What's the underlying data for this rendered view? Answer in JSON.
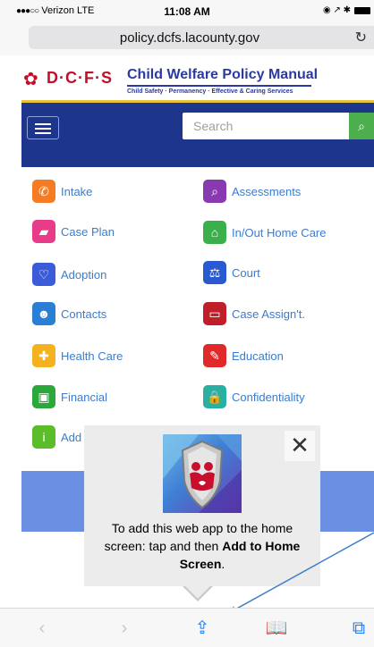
{
  "status_bar": {
    "signal_dots": "●●●○○",
    "carrier": "Verizon",
    "network": "LTE",
    "time": "11:08 AM",
    "right_icons": "◉ ↗ ✱"
  },
  "address_bar": {
    "url": "policy.dcfs.lacounty.gov",
    "reload_icon": "reload-icon"
  },
  "site": {
    "logo_text": "D·C·F·S",
    "title": "Child Welfare Policy Manual",
    "tagline": "Child Safety · Permanency · Effective & Caring Services",
    "search_placeholder": "Search",
    "accent_color": "#1d368c"
  },
  "menu": {
    "left": [
      {
        "label": "Intake",
        "icon": "phone-icon",
        "color": "#f57c22"
      },
      {
        "label": "Case Plan",
        "icon": "folder-icon",
        "color": "#e83b8a"
      },
      {
        "label": "Adoption",
        "icon": "heart-icon",
        "color": "#3b5bd8"
      },
      {
        "label": "Contacts",
        "icon": "contacts-icon",
        "color": "#2a7fd4"
      },
      {
        "label": "Health Care",
        "icon": "medical-kit-icon",
        "color": "#f4b21e"
      },
      {
        "label": "Financial",
        "icon": "money-icon",
        "color": "#2aa83a"
      },
      {
        "label": "Add",
        "icon": "info-icon",
        "color": "#5cbd2b"
      }
    ],
    "right": [
      {
        "label": "Assessments",
        "icon": "search-icon",
        "color": "#8a3ab0"
      },
      {
        "label": "In/Out Home Care",
        "icon": "home-icon",
        "color": "#3bb04a"
      },
      {
        "label": "Court",
        "icon": "scales-icon",
        "color": "#2a5ad0"
      },
      {
        "label": "Case Assign't.",
        "icon": "folder-open-icon",
        "color": "#c01f2a"
      },
      {
        "label": "Education",
        "icon": "pencil-icon",
        "color": "#e02a2a"
      },
      {
        "label": "Confidentiality",
        "icon": "lock-icon",
        "color": "#2ab0a0"
      }
    ]
  },
  "popup": {
    "text_before": "To add this web app to the home screen: tap",
    "text_middle": " and then ",
    "text_bold": "Add to Home Screen",
    "text_end": "."
  },
  "toolbar": {
    "back": "‹",
    "forward": "›",
    "share": "⇪",
    "bookmarks": "📖",
    "tabs": "⧉"
  }
}
